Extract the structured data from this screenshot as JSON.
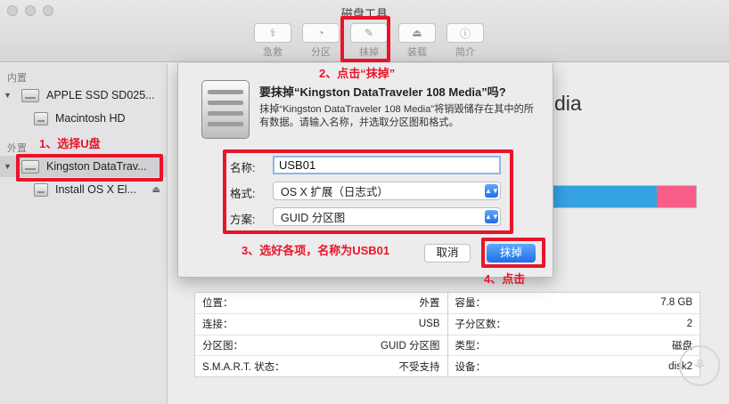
{
  "window": {
    "title": "磁盘工具"
  },
  "toolbar": [
    {
      "label": "急救",
      "icon": "stethoscope-icon",
      "glyph": "⚕"
    },
    {
      "label": "分区",
      "icon": "partition-icon",
      "glyph": "◔"
    },
    {
      "label": "抹掉",
      "icon": "erase-icon",
      "glyph": "✎"
    },
    {
      "label": "装载",
      "icon": "mount-icon",
      "glyph": "⏏"
    },
    {
      "label": "简介",
      "icon": "info-icon",
      "glyph": "ⓘ"
    }
  ],
  "sidebar": {
    "internal_label": "内置",
    "external_label": "外置",
    "internal_disk": "APPLE SSD SD025...",
    "internal_volume": "Macintosh HD",
    "external_disk": "Kingston DataTrav...",
    "external_volume": "Install OS X El...",
    "triangle": "▼",
    "eject": "⏏"
  },
  "main": {
    "title_suffix": "dia"
  },
  "info": {
    "left": [
      {
        "key": "位置：",
        "value": "外置"
      },
      {
        "key": "连接：",
        "value": "USB"
      },
      {
        "key": "分区图：",
        "value": "GUID 分区图"
      },
      {
        "key": "S.M.A.R.T. 状态：",
        "value": "不受支持"
      }
    ],
    "right": [
      {
        "key": "容量：",
        "value": "7.8 GB"
      },
      {
        "key": "子分区数：",
        "value": "2"
      },
      {
        "key": "类型：",
        "value": "磁盘"
      },
      {
        "key": "设备：",
        "value": "disk2"
      }
    ]
  },
  "sheet": {
    "title": "要抹掉“Kingston DataTraveler 108 Media”吗?",
    "description": "抹掉“Kingston DataTraveler 108 Media”将销毁储存在其中的所有数据。请输入名称，并选取分区图和格式。",
    "name_label": "名称:",
    "name_value": "USB01",
    "format_label": "格式:",
    "format_value": "OS X 扩展（日志式）",
    "scheme_label": "方案:",
    "scheme_value": "GUID 分区图",
    "select_arrows": "▲▼",
    "cancel_label": "取消",
    "erase_label": "抹掉"
  },
  "annotations": {
    "step1": "1、选择U盘",
    "step2": "2、点击“抹掉”",
    "step3": "3、选好各项，名称为USB01",
    "step4": "4、点击"
  },
  "colors": {
    "accent": "#1f6fe6",
    "annotation": "#e8152a",
    "usage_used": "#35a3e2",
    "usage_other": "#f75d87"
  },
  "usage": {
    "used_fraction": 0.72
  }
}
